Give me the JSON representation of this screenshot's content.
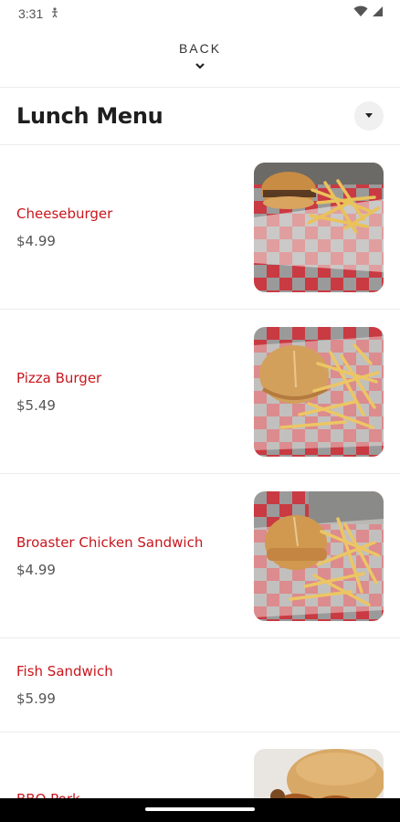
{
  "status": {
    "time": "3:31"
  },
  "nav": {
    "back_label": "BACK"
  },
  "menu": {
    "title": "Lunch Menu",
    "items": [
      {
        "name": "Cheeseburger",
        "price": "$4.99"
      },
      {
        "name": "Pizza Burger",
        "price": "$5.49"
      },
      {
        "name": "Broaster Chicken Sandwich",
        "price": "$4.99"
      },
      {
        "name": "Fish Sandwich",
        "price": "$5.99"
      },
      {
        "name": "BBQ Pork"
      }
    ]
  },
  "colors": {
    "accent": "#c8161d",
    "text": "#1e1e1e",
    "price": "#555555"
  }
}
